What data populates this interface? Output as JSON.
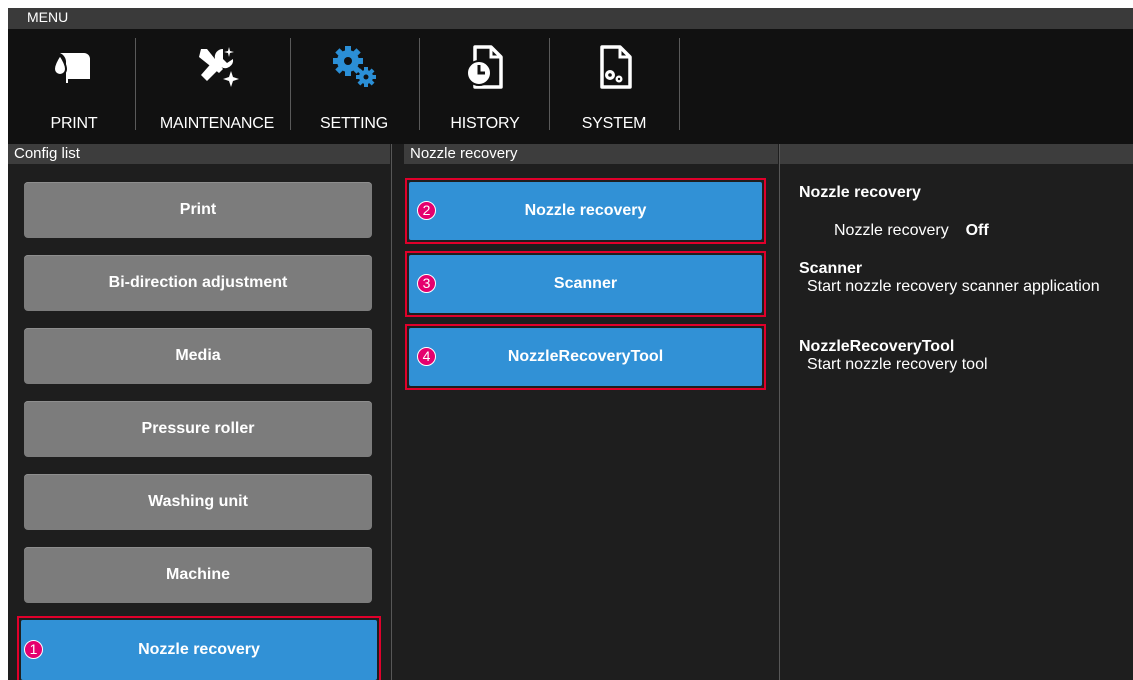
{
  "menu": {
    "title": "MENU",
    "items": [
      {
        "label": "PRINT",
        "icon": "print-icon"
      },
      {
        "label": "MAINTENANCE",
        "icon": "tools-icon"
      },
      {
        "label": "SETTING",
        "icon": "gears-icon",
        "active_color": "#2b8fd6"
      },
      {
        "label": "HISTORY",
        "icon": "history-icon"
      },
      {
        "label": "SYSTEM",
        "icon": "system-icon"
      }
    ]
  },
  "config_list": {
    "header": "Config list",
    "items": [
      {
        "label": "Print"
      },
      {
        "label": "Bi-direction adjustment"
      },
      {
        "label": "Media"
      },
      {
        "label": "Pressure roller"
      },
      {
        "label": "Washing unit"
      },
      {
        "label": "Machine"
      },
      {
        "label": "Nozzle recovery",
        "selected": true,
        "marker": "1"
      }
    ]
  },
  "nozzle_panel": {
    "header": "Nozzle recovery",
    "buttons": [
      {
        "label": "Nozzle recovery",
        "marker": "2"
      },
      {
        "label": "Scanner",
        "marker": "3"
      },
      {
        "label": "NozzleRecoveryTool",
        "marker": "4"
      }
    ]
  },
  "info_panel": {
    "sections": [
      {
        "title": "Nozzle recovery",
        "setting_label": "Nozzle recovery",
        "setting_value": "Off"
      },
      {
        "title": "Scanner",
        "description": "Start nozzle recovery scanner application"
      },
      {
        "title": "NozzleRecoveryTool",
        "description": "Start nozzle recovery tool"
      }
    ]
  },
  "colors": {
    "button_gray": "#7c7c7c",
    "button_blue": "#3191d6",
    "highlight_red": "#e0002b",
    "marker_magenta": "#e5006e",
    "background": "#1e1e1e"
  }
}
